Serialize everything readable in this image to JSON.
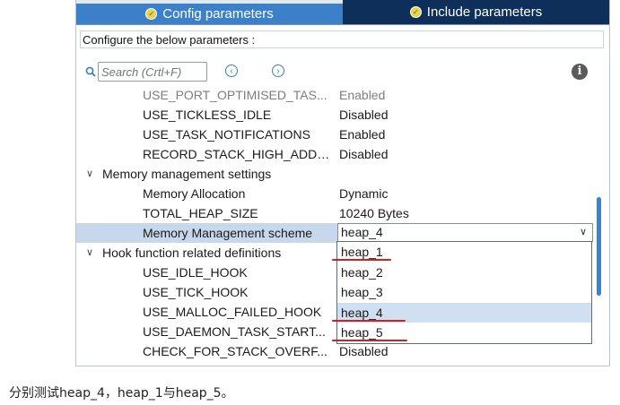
{
  "tabs": [
    {
      "label": "Config parameters",
      "active": true
    },
    {
      "label": "Include parameters",
      "active": false
    }
  ],
  "configure_label": "Configure the below parameters :",
  "search": {
    "placeholder": "Search (Crtl+F)"
  },
  "nav": {
    "prev": "‹",
    "next": "›"
  },
  "info_icon": "i",
  "rows": [
    {
      "name": "USE_PORT_OPTIMISED_TAS...",
      "value": "Enabled"
    },
    {
      "name": "USE_TICKLESS_IDLE",
      "value": "Disabled"
    },
    {
      "name": "USE_TASK_NOTIFICATIONS",
      "value": "Enabled"
    },
    {
      "name": "RECORD_STACK_HIGH_ADDR...",
      "value": "Disabled"
    }
  ],
  "memory_group": {
    "label": "Memory management settings",
    "rows": [
      {
        "name": "Memory Allocation",
        "value": "Dynamic"
      },
      {
        "name": "TOTAL_HEAP_SIZE",
        "value": "10240 Bytes"
      },
      {
        "name": "Memory Management scheme",
        "value": "heap_4"
      }
    ]
  },
  "hook_group": {
    "label": "Hook function related definitions",
    "rows": [
      {
        "name": "USE_IDLE_HOOK"
      },
      {
        "name": "USE_TICK_HOOK"
      },
      {
        "name": "USE_MALLOC_FAILED_HOOK"
      },
      {
        "name": "USE_DAEMON_TASK_START..."
      },
      {
        "name": "CHECK_FOR_STACK_OVERF...",
        "value": "Disabled"
      }
    ]
  },
  "dropdown_options": [
    "heap_1",
    "heap_2",
    "heap_3",
    "heap_4",
    "heap_5"
  ],
  "dropdown_highlight": "heap_4",
  "colors": {
    "tab_active": "#3b80c9",
    "tab_inactive": "#0d2f59",
    "selection": "#c7d8ec",
    "annotation_red": "#d62020",
    "scrollbar": "#3e82cc"
  },
  "caption": "分别测试heap_4，heap_1与heap_5。"
}
